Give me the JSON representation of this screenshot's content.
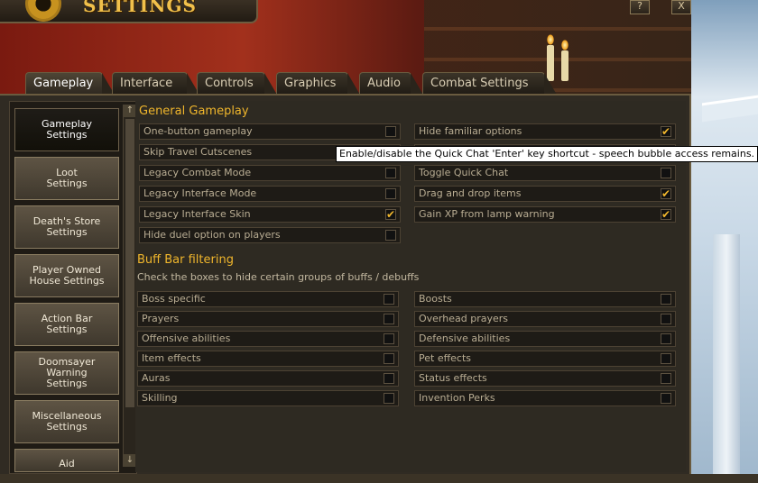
{
  "window": {
    "title": "SETTINGS",
    "help_label": "?",
    "close_label": "X"
  },
  "tabs": [
    {
      "label": "Gameplay",
      "active": true
    },
    {
      "label": "Interface"
    },
    {
      "label": "Controls"
    },
    {
      "label": "Graphics"
    },
    {
      "label": "Audio"
    },
    {
      "label": "Combat Settings"
    }
  ],
  "sidebar": {
    "items": [
      {
        "label": "Gameplay\nSettings",
        "active": true
      },
      {
        "label": "Loot\nSettings"
      },
      {
        "label": "Death's Store\nSettings"
      },
      {
        "label": "Player Owned\nHouse Settings"
      },
      {
        "label": "Action Bar\nSettings"
      },
      {
        "label": "Doomsayer\nWarning\nSettings"
      },
      {
        "label": "Miscellaneous\nSettings"
      },
      {
        "label": "Aid"
      }
    ],
    "scroll_up": "↑",
    "scroll_down": "↓"
  },
  "general": {
    "title": "General Gameplay",
    "left": [
      {
        "label": "One-button gameplay",
        "checked": false
      },
      {
        "label": "Skip Travel Cutscenes",
        "checked": false
      },
      {
        "label": "Legacy Combat Mode",
        "checked": false
      },
      {
        "label": "Legacy Interface Mode",
        "checked": false
      },
      {
        "label": "Legacy Interface Skin",
        "checked": true
      },
      {
        "label": "Hide duel option on players",
        "checked": false
      }
    ],
    "right": [
      {
        "label": "Hide familiar options",
        "checked": true
      },
      {
        "label": "",
        "checked": false
      },
      {
        "label": "Toggle Quick Chat",
        "checked": false
      },
      {
        "label": "Drag and drop items",
        "checked": true
      },
      {
        "label": "Gain XP from lamp warning",
        "checked": true
      }
    ]
  },
  "tooltip": "Enable/disable the Quick Chat 'Enter' key shortcut - speech bubble access remains.",
  "buffbar": {
    "title": "Buff Bar filtering",
    "description": "Check the boxes to hide certain groups of buffs / debuffs",
    "left": [
      {
        "label": "Boss specific",
        "checked": false
      },
      {
        "label": "Prayers",
        "checked": false
      },
      {
        "label": "Offensive abilities",
        "checked": false
      },
      {
        "label": "Item effects",
        "checked": false
      },
      {
        "label": "Auras",
        "checked": false
      },
      {
        "label": "Skilling",
        "checked": false
      }
    ],
    "right": [
      {
        "label": "Boosts",
        "checked": false
      },
      {
        "label": "Overhead prayers",
        "checked": false
      },
      {
        "label": "Defensive abilities",
        "checked": false
      },
      {
        "label": "Pet effects",
        "checked": false
      },
      {
        "label": "Status effects",
        "checked": false
      },
      {
        "label": "Invention Perks",
        "checked": false
      }
    ]
  },
  "colors": {
    "accent": "#f0b62c",
    "panel": "#302b23",
    "text": "#b9ad93"
  }
}
